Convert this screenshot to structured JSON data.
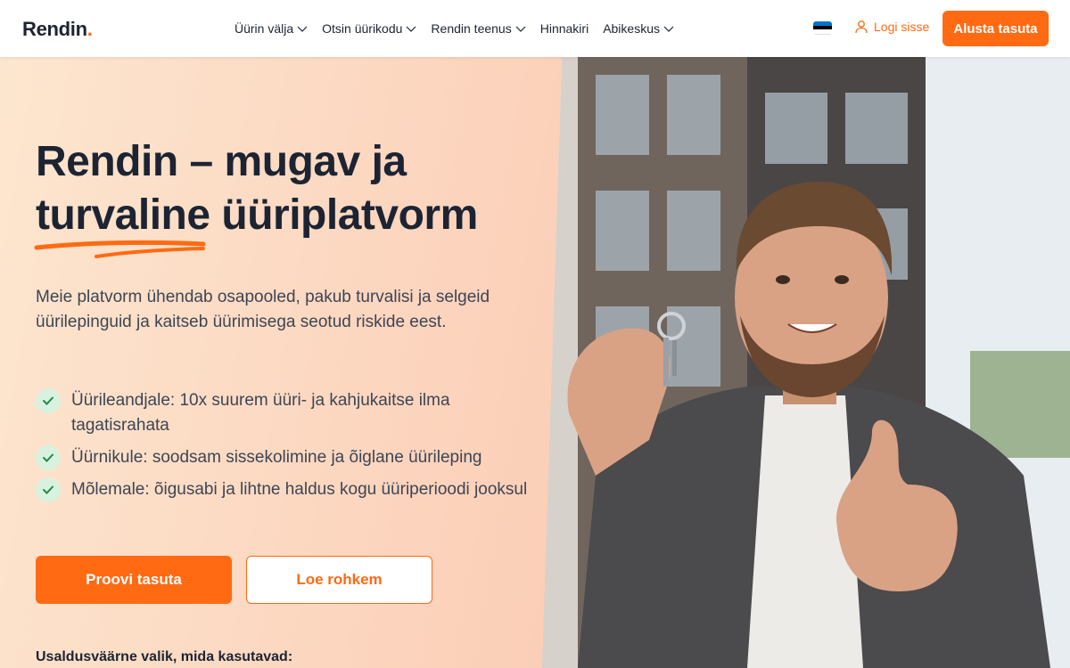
{
  "brand": {
    "name": "Rendin",
    "dot": ".",
    "accent": "#ff6a13"
  },
  "nav": {
    "items": [
      {
        "label": "Üürin välja",
        "dropdown": true
      },
      {
        "label": "Otsin üürikodu",
        "dropdown": true
      },
      {
        "label": "Rendin teenus",
        "dropdown": true
      },
      {
        "label": "Hinnakiri",
        "dropdown": false
      },
      {
        "label": "Abikeskus",
        "dropdown": true
      }
    ],
    "language_flag": "estonian-flag-icon",
    "login_label": "Logi sisse",
    "cta_label": "Alusta tasuta"
  },
  "hero": {
    "title_line1": "Rendin – mugav ja",
    "title_highlight": "turvaline",
    "title_rest": " üüriplatvorm",
    "description": "Meie platvorm ühendab osapooled, pakub turvalisi ja selgeid üürilepinguid ja kaitseb üürimisega seotud riskide eest.",
    "bullets": [
      "Üürileandjale: 10x suurem üüri- ja kahjukaitse ilma tagatisrahata",
      "Üürnikule: soodsam sissekolimine ja õiglane üürileping",
      "Mõlemale: õigusabi ja lihtne haldus kogu üüriperioodi jooksul"
    ],
    "primary_button": "Proovi tasuta",
    "secondary_button": "Loe rohkem",
    "trusted_label": "Usaldusväärne valik, mida kasutavad:",
    "photo": "man-holding-keys-thumbs-up-photo"
  }
}
